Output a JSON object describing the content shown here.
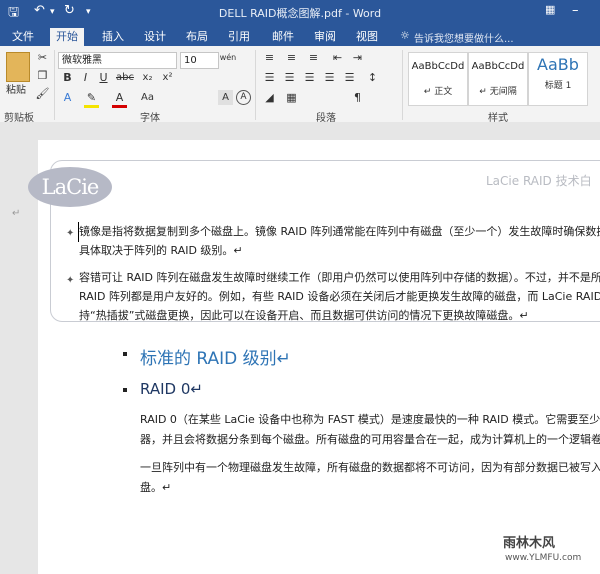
{
  "window": {
    "title": "DELL RAID概念图解.pdf - Word"
  },
  "quick_access": {
    "save_icon": "save-icon",
    "undo_icon": "undo-icon",
    "redo_icon": "redo-icon"
  },
  "tabs": [
    "文件",
    "开始",
    "插入",
    "设计",
    "布局",
    "引用",
    "邮件",
    "审阅",
    "视图"
  ],
  "active_tab": "开始",
  "tell_me": {
    "placeholder": "告诉我您想要做什么..."
  },
  "ribbon": {
    "clipboard": {
      "paste_label": "粘贴",
      "group_label": "剪贴板"
    },
    "font": {
      "family": "微软雅黑",
      "size": "10",
      "group_label": "字体"
    },
    "paragraph": {
      "group_label": "段落"
    },
    "styles": {
      "group_label": "样式",
      "items": [
        {
          "sample": "AaBbCcDd",
          "name": "↵ 正文"
        },
        {
          "sample": "AaBbCcDd",
          "name": "↵ 无间隔"
        },
        {
          "sample": "AaBb",
          "name": "标题 1"
        }
      ]
    }
  },
  "document": {
    "logo_text": "LaCie",
    "header_right": "LaCie RAID 技术白",
    "card_paragraphs": [
      [
        "镜像是指将数据复制到多个磁盘上。镜像 RAID 阵列通常能在阵列中有磁盘（至少一个）发生故障时确保数据",
        "具体取决于阵列的 RAID 级别。↵"
      ],
      [
        "容错可让 RAID 阵列在磁盘发生故障时继续工作（即用户仍然可以使用阵列中存储的数据）。不过，并不是所",
        "RAID 阵列都是用户友好的。例如，有些 RAID 设备必须在关闭后才能更换发生故障的磁盘，而 LaCie RAID",
        "持“热插拔”式磁盘更换，因此可以在设备开启、而且数据可供访问的情况下更换故障磁盘。↵"
      ]
    ],
    "heading1": "标准的 RAID 级别↵",
    "heading2": "RAID 0↵",
    "body_paragraphs": [
      [
        "RAID 0（在某些 LaCie 设备中也称为 FAST 模式）是速度最快的一种 RAID 模式。它需要至少两",
        "器，并且会将数据分条到每个磁盘。所有磁盘的可用容量合在一起，成为计算机上的一个逻辑卷。"
      ],
      [
        "一旦阵列中有一个物理磁盘发生故障，所有磁盘的数据都将不可访问，因为有部分数据已被写入",
        "盘。↵"
      ]
    ]
  },
  "watermark": {
    "name": "雨林木风",
    "url": "www.YLMFU.com"
  },
  "colors": {
    "title_bar": "#2b579a",
    "heading1": "#2e74b5",
    "heading2": "#1f3863"
  }
}
